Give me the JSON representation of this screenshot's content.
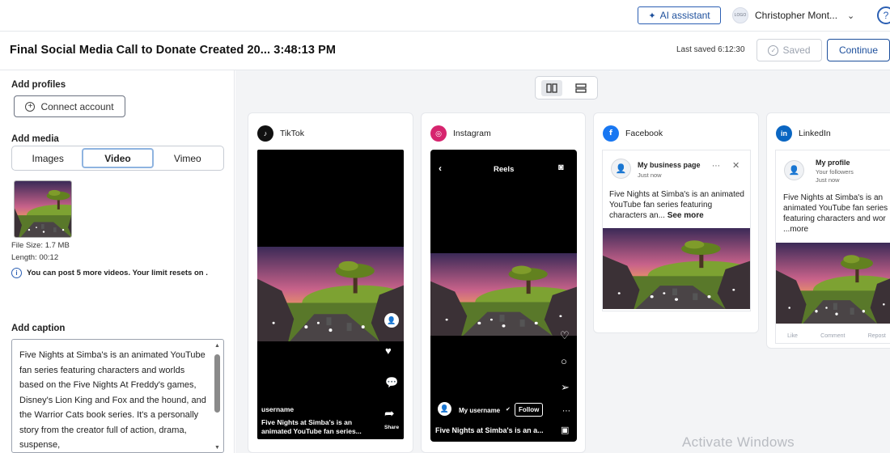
{
  "topbar": {
    "ai_label": "AI assistant",
    "user_name": "Christopher Mont...",
    "avatar_text": "LOGO",
    "help_glyph": "?"
  },
  "header": {
    "title": "Final Social Media Call to Donate Created 20... 3:48:13 PM",
    "last_saved": "Last saved 6:12:30",
    "saved_label": "Saved",
    "continue_label": "Continue"
  },
  "left": {
    "profiles_label": "Add profiles",
    "connect_label": "Connect account",
    "media_label": "Add media",
    "media_tabs": [
      "Images",
      "Video",
      "Vimeo"
    ],
    "media_tab_selected": "Video",
    "file_size": "File Size: 1.7 MB",
    "length": "Length: 00:12",
    "notice": "You can post 5 more videos. Your limit resets on .",
    "caption_label": "Add caption",
    "caption": "Five Nights at Simba's is an animated YouTube fan series featuring characters and worlds based on the Five Nights At Freddy's games, Disney's Lion King and Fox and the hound, and the Warrior Cats book series. It's a personally story from the creator full of action, drama, suspense,"
  },
  "previews": {
    "tiktok": {
      "network": "TikTok",
      "username": "username",
      "caption": "Five Nights at Simba's is an animated YouTube fan series...",
      "share_label": "Share"
    },
    "instagram": {
      "network": "Instagram",
      "reels_label": "Reels",
      "username": "My username",
      "follow_label": "Follow",
      "caption": "Five Nights at Simba's is an a..."
    },
    "facebook": {
      "network": "Facebook",
      "page_name": "My business page",
      "time": "Just now",
      "text": "Five Nights at Simba's is an animated YouTube fan series featuring characters an...",
      "see_more": "See more"
    },
    "linkedin": {
      "network": "LinkedIn",
      "profile_name": "My profile",
      "followers": "Your followers",
      "time": "Just now",
      "text": "Five Nights at Simba's is an animated YouTube fan series featuring characters and wor",
      "more": "...more",
      "actions": [
        "Like",
        "Comment",
        "Repost"
      ]
    }
  },
  "watermark": "Activate Windows",
  "colors": {
    "accent": "#1d4f9c",
    "tiktok": "#111111",
    "instagram": "#d6246e",
    "facebook": "#1877f2",
    "linkedin": "#0a66c2"
  }
}
